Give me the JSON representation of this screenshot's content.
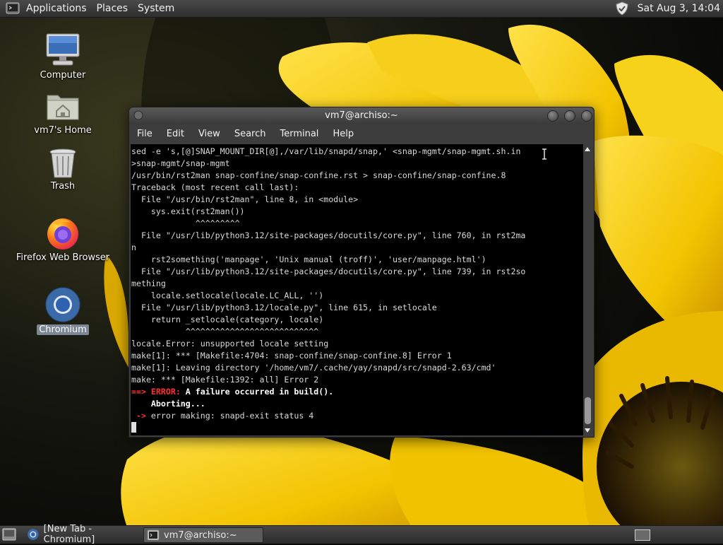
{
  "top_panel": {
    "menus": [
      "Applications",
      "Places",
      "System"
    ],
    "clock": "Sat Aug  3, 14:04"
  },
  "desktop_icons": [
    {
      "label": "Computer",
      "icon": "computer-icon"
    },
    {
      "label": "vm7's Home",
      "icon": "home-folder-icon"
    },
    {
      "label": "Trash",
      "icon": "trash-icon"
    },
    {
      "label": "Firefox Web Browser",
      "icon": "firefox-icon"
    },
    {
      "label": "Chromium",
      "icon": "chromium-icon",
      "selected": true
    }
  ],
  "terminal": {
    "title": "vm7@archiso:~",
    "menu": [
      "File",
      "Edit",
      "View",
      "Search",
      "Terminal",
      "Help"
    ],
    "lines": [
      "sed -e 's,[@]SNAP_MOUNT_DIR[@],/var/lib/snapd/snap,' <snap-mgmt/snap-mgmt.sh.in",
      ">snap-mgmt/snap-mgmt",
      "/usr/bin/rst2man snap-confine/snap-confine.rst > snap-confine/snap-confine.8",
      "Traceback (most recent call last):",
      "  File \"/usr/bin/rst2man\", line 8, in <module>",
      "    sys.exit(rst2man())",
      "             ^^^^^^^^^",
      "  File \"/usr/lib/python3.12/site-packages/docutils/core.py\", line 760, in rst2ma",
      "n",
      "    rst2something('manpage', 'Unix manual (troff)', 'user/manpage.html')",
      "  File \"/usr/lib/python3.12/site-packages/docutils/core.py\", line 739, in rst2so",
      "mething",
      "    locale.setlocale(locale.LC_ALL, '')",
      "  File \"/usr/lib/python3.12/locale.py\", line 615, in setlocale",
      "    return _setlocale(category, locale)",
      "           ^^^^^^^^^^^^^^^^^^^^^^^^^^^",
      "locale.Error: unsupported locale setting",
      "make[1]: *** [Makefile:4704: snap-confine/snap-confine.8] Error 1",
      "make[1]: Leaving directory '/home/vm7/.cache/yay/snapd/src/snapd-2.63/cmd'",
      "make: *** [Makefile:1392: all] Error 2"
    ],
    "error_prefix": "==> ERROR:",
    "error_message": " A failure occurred in build().",
    "aborting": "    Aborting...",
    "exit_arrow": " ->",
    "exit_message": " error making: snapd-exit status 4"
  },
  "taskbar": {
    "items": [
      {
        "label": "[New Tab - Chromium]",
        "icon": "chromium-icon",
        "active": false
      },
      {
        "label": "vm7@archiso:~",
        "icon": "terminal-icon",
        "active": true
      }
    ]
  },
  "colors": {
    "error": "#ff3030",
    "terminal_bg": "#000000",
    "panel": "#3a3a3a",
    "selection": "#7b8794"
  }
}
